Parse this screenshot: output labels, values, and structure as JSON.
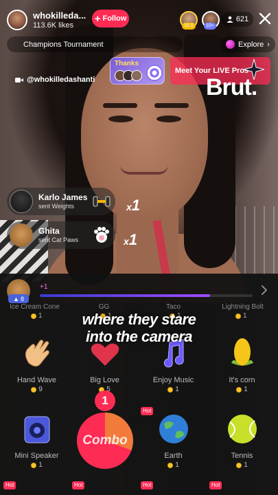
{
  "host": {
    "name": "whokilleda...",
    "likes": "113.6K likes",
    "follow_label": "Follow"
  },
  "top_viewers": [
    {
      "badge": "10.0"
    },
    {
      "badge": "10+"
    }
  ],
  "viewer_count": "621",
  "subheader": {
    "title": "Champions Tournament",
    "explore_label": "Explore"
  },
  "overlay": {
    "handle": "@whokilledashanti",
    "thanks_label": "Thanks",
    "promo_label": "Meet Your LIVE Pros",
    "brand": "Brut."
  },
  "notifications": [
    {
      "name": "Karlo James",
      "action": "sent Weights",
      "count": "1"
    },
    {
      "name": "Ghita",
      "action": "sent Cat Paws",
      "count": "1"
    }
  ],
  "panel": {
    "level": "8",
    "increment": "+1",
    "progress": 0.8,
    "top_row": [
      {
        "name": "Ice Cream Cone",
        "price": "1"
      },
      {
        "name": "GG",
        "price": "1"
      },
      {
        "name": "Taco",
        "price": "1"
      },
      {
        "name": "Lightning Bolt",
        "price": "1"
      }
    ],
    "row2": [
      {
        "name": "Hand Wave",
        "price": "9"
      },
      {
        "name": "Big Love",
        "price": "5"
      },
      {
        "name": "Enjoy Music",
        "price": "1"
      },
      {
        "name": "It's corn",
        "price": "1"
      }
    ],
    "row3": [
      {
        "name": "Mini Speaker",
        "price": "1"
      },
      {
        "name": "Earth",
        "price": "1"
      },
      {
        "name": "Tennis",
        "price": "1"
      }
    ],
    "hot_label": "Hot",
    "combo": {
      "label": "Combo",
      "count": "1"
    }
  },
  "caption": {
    "line1": "where they stare",
    "line2": "into the camera"
  },
  "colors": {
    "accent": "#fe2c55",
    "coin": "#f7c52f",
    "level": "#4b63d9"
  }
}
